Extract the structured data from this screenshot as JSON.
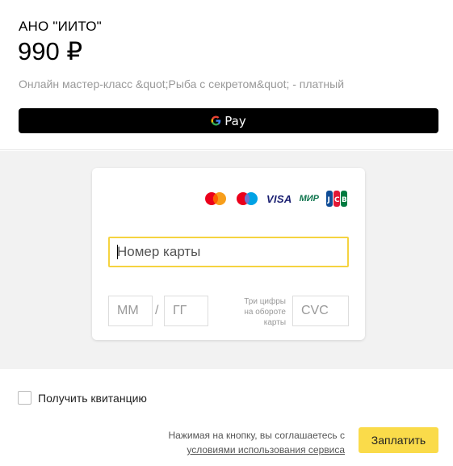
{
  "header": {
    "merchant": "АНО \"ИИТО\"",
    "amount": "990 ₽",
    "description": "Онлайн мастер-класс &quot;Рыба с секретом&quot; - платный"
  },
  "gpay": {
    "label": "Pay",
    "icon": "google-g-icon"
  },
  "card_form": {
    "logos": [
      {
        "name": "mastercard",
        "icon": "mastercard-logo"
      },
      {
        "name": "maestro",
        "icon": "maestro-logo"
      },
      {
        "name": "visa",
        "text": "VISA"
      },
      {
        "name": "mir",
        "text": "МИР"
      },
      {
        "name": "jcb",
        "text": "JCB"
      }
    ],
    "card_number_placeholder": "Номер карты",
    "month_placeholder": "ММ",
    "separator": "/",
    "year_placeholder": "ГГ",
    "cvc_hint": "Три цифры на обороте карты",
    "cvc_placeholder": "CVC"
  },
  "footer": {
    "receipt_label": "Получить квитанцию",
    "terms_text": "Нажимая на кнопку, вы соглашаетесь с",
    "terms_link": "условиями использования сервиса",
    "pay_button": "Заплатить"
  },
  "colors": {
    "accent_yellow": "#fadb4a",
    "focus_border": "#f5d340",
    "gpay_bg": "#000000",
    "panel_bg": "#f2f2f2"
  }
}
